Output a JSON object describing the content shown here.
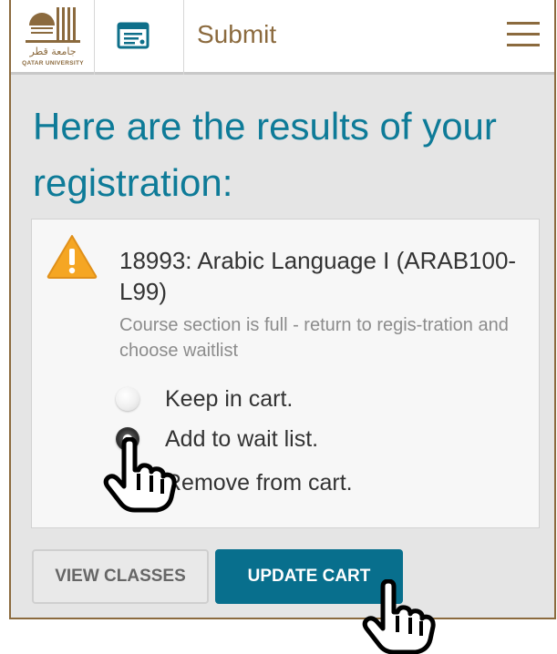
{
  "header": {
    "logo_arabic": "جامعة قطر",
    "logo_english": "QATAR UNIVERSITY",
    "title": "Submit",
    "menu_icon": "hamburger-menu-icon",
    "form_icon": "form-id-card-icon"
  },
  "main": {
    "heading": "Here are the results of your registration:"
  },
  "card": {
    "warning_icon": "warning-triangle-icon",
    "course_title": "18993: Arabic Language I (ARAB100-L99)",
    "message": "Course section is full - return to regis-tration and choose waitlist",
    "options": [
      {
        "label": "Keep in cart.",
        "checked": false
      },
      {
        "label": "Add to wait list.",
        "checked": true
      },
      {
        "label": "Remove from cart.",
        "checked": false
      }
    ]
  },
  "buttons": {
    "view_classes": "VIEW CLASSES",
    "update_cart": "UPDATE CART"
  },
  "colors": {
    "brand_gold": "#8b6a3e",
    "heading_teal": "#0e7b98",
    "primary_button": "#086f8d",
    "warning_orange": "#f5a623"
  }
}
